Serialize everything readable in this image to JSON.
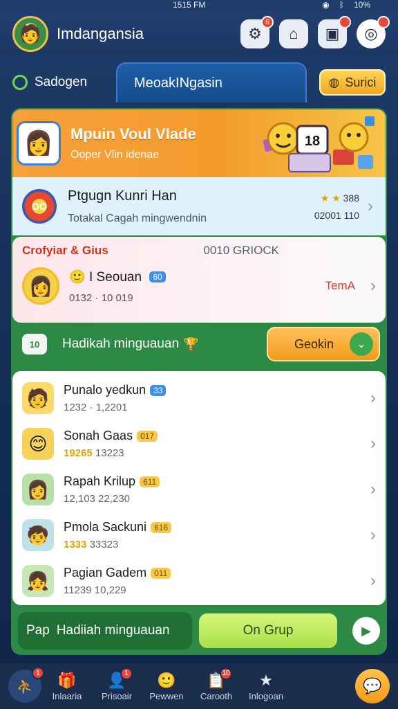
{
  "status": {
    "time": "1515 FM",
    "battery": "10%"
  },
  "header": {
    "title": "Imdangansia",
    "badges": [
      "6",
      "",
      "",
      ""
    ]
  },
  "tabs": {
    "left": "Sadogen",
    "active": "MeoakINgasin",
    "right": "Surici"
  },
  "banner": {
    "title": "Mpuin Voul Vlade",
    "subtitle": "Ooper Vlin idenae",
    "deco_number": "18"
  },
  "feature_row": {
    "title": "Ptgugn Kunri Han",
    "subtitle": "Totakal Cagah mingwendnin",
    "meta1": "388",
    "meta2": "02001 110"
  },
  "group_card": {
    "heading": "Crofyiar & Gius",
    "heading_right": "0010 GRIOCK",
    "name": "I Seouan",
    "tag": "60",
    "stats": "0132 · 10 019",
    "status": "TemA"
  },
  "reward": {
    "box": "10",
    "label": "Hadikah minguauan",
    "button": "Geokin"
  },
  "list": [
    {
      "name": "Punalo yedkun",
      "tag": "33",
      "sub": "1232 · 1,2201",
      "sub_highlight": "",
      "avatar": "🧑",
      "bg": "#fcd96a"
    },
    {
      "name": "Sonah Gaas",
      "tag": "017",
      "sub": "13223",
      "sub_highlight": "19265",
      "avatar": "😊",
      "bg": "#f6d25a"
    },
    {
      "name": "Rapah Krilup",
      "tag": "611",
      "sub": "12,103 22,230",
      "sub_highlight": "",
      "avatar": "👩",
      "bg": "#b9e0a8"
    },
    {
      "name": "Pmola Sackuni",
      "tag": "616",
      "sub": "33323",
      "sub_highlight": "1333",
      "avatar": "🧒",
      "bg": "#bfe2ea"
    },
    {
      "name": "Pagian Gadem",
      "tag": "011",
      "sub": "11239 10,229",
      "sub_highlight": "",
      "avatar": "👧",
      "bg": "#c8e6b6"
    }
  ],
  "footer_bar": {
    "pill_prefix": "Pap",
    "pill_label": "Hadiiah minguauan",
    "grup_button": "On Grup"
  },
  "navbar": [
    {
      "label": "Inlaaria",
      "icon": "🎁",
      "badge": ""
    },
    {
      "label": "Prisoair",
      "icon": "👤",
      "badge": "1"
    },
    {
      "label": "Pewwen",
      "icon": "🙂",
      "badge": ""
    },
    {
      "label": "Carooth",
      "icon": "📋",
      "badge": "10"
    },
    {
      "label": "Inlogoan",
      "icon": "★",
      "badge": ""
    }
  ],
  "colors": {
    "accent": "#2d8a44",
    "banner": "#f39b2d",
    "badge": "#e8483a"
  }
}
